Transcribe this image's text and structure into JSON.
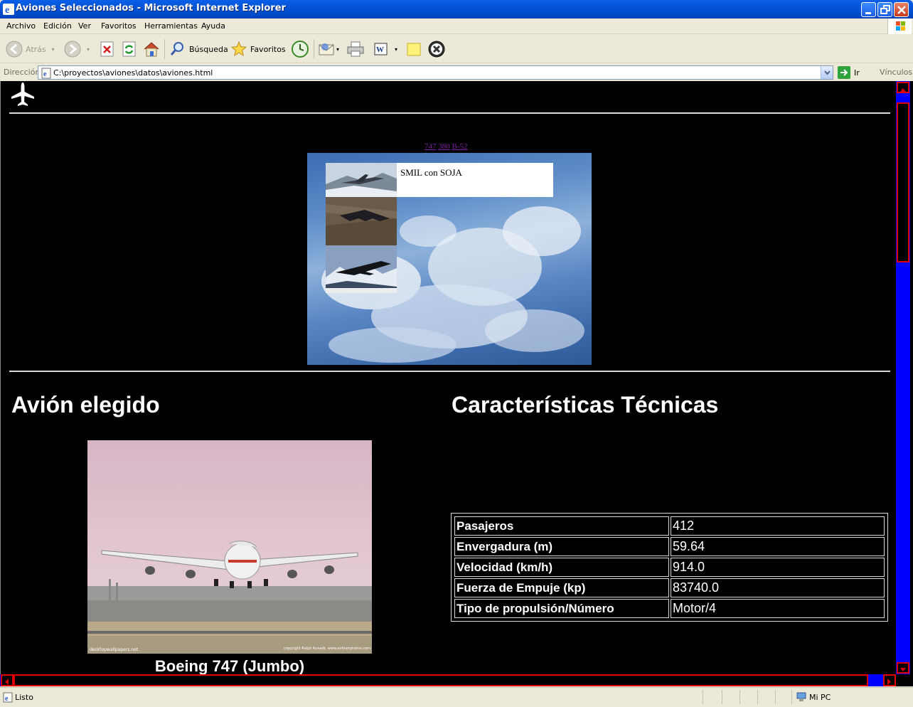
{
  "window": {
    "title": "Aviones Seleccionados - Microsoft Internet Explorer"
  },
  "menu": {
    "items": [
      "Archivo",
      "Edición",
      "Ver",
      "Favoritos",
      "Herramientas",
      "Ayuda"
    ]
  },
  "toolbar": {
    "back_label": "Atrás",
    "search_label": "Búsqueda",
    "favorites_label": "Favoritos",
    "icons": [
      "back-icon",
      "forward-icon",
      "stop-icon",
      "refresh-icon",
      "home-icon",
      "search-icon",
      "favorites-icon",
      "history-icon",
      "mail-icon",
      "print-icon",
      "edit-icon",
      "note-icon",
      "close-circle-icon"
    ]
  },
  "address": {
    "label": "Dirección",
    "url": "C:\\proyectos\\aviones\\datos\\aviones.html",
    "go_label": "Ir",
    "links_label": "Vínculos"
  },
  "page": {
    "smil_links": [
      "747",
      "380",
      "B-52"
    ],
    "smil_caption": "SMIL con SOJA",
    "heading_left": "Avión elegido",
    "heading_right": "Características Técnicas",
    "photo_caption": "Boeing 747 (Jumbo)",
    "photo_credit_left": "desktopwallpapers.net",
    "photo_credit_right": "copyright Ralph Kunadt, www.airlinerphotos.com",
    "specs": [
      {
        "label": "Pasajeros",
        "value": "412"
      },
      {
        "label": "Envergadura (m)",
        "value": "59.64"
      },
      {
        "label": "Velocidad (km/h)",
        "value": "914.0"
      },
      {
        "label": "Fuerza de Empuje (kp)",
        "value": "83740.0"
      },
      {
        "label": "Tipo de propulsión/Número",
        "value": "Motor/4"
      }
    ]
  },
  "status": {
    "text": "Listo",
    "zone": "Mi PC"
  },
  "colors": {
    "page_background": "#000000",
    "scrollbar_track": "#0000ff",
    "scrollbar_border": "#e00000",
    "link_visited": "#7a1fa0",
    "titlebar_blue": "#0554d8"
  }
}
